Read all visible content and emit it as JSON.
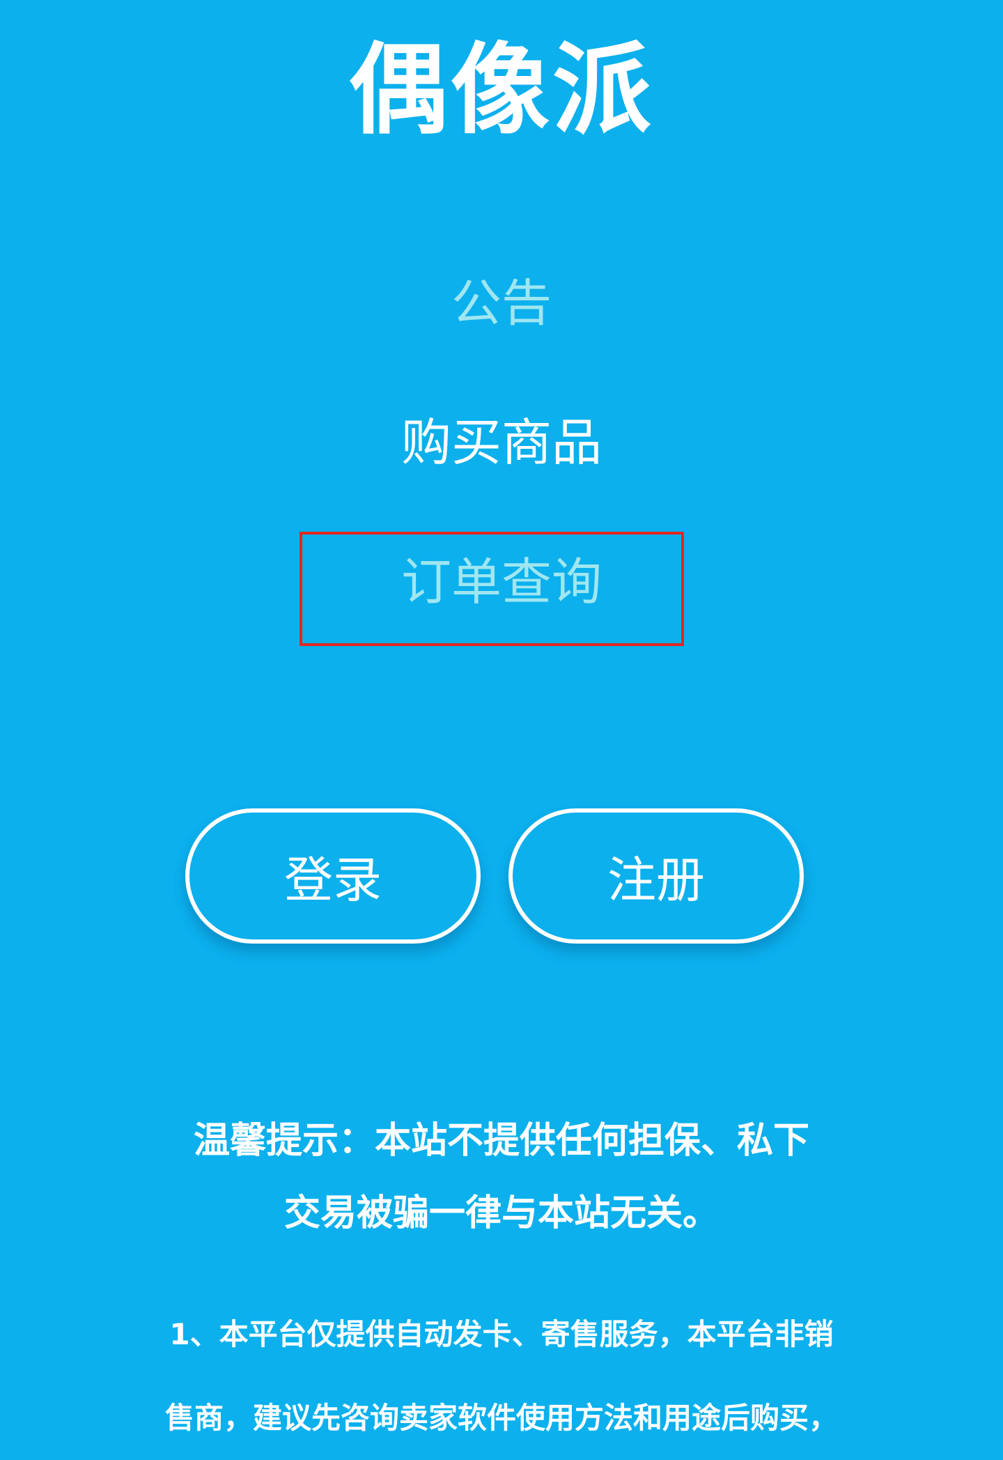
{
  "site": {
    "title": "偶像派"
  },
  "nav": {
    "notice": "公告",
    "buy": "购买商品",
    "order_query": "订单查询"
  },
  "auth": {
    "login_label": "登录",
    "register_label": "注册"
  },
  "notice": {
    "line1": "温馨提示：本站不提供任何担保、私下",
    "line2": "交易被骗一律与本站无关。"
  },
  "rules": {
    "line1": "1、本平台仅提供自动发卡、寄售服务，本平台非销",
    "line2": "售商，建议先咨询卖家软件使用方法和用途后购买，"
  },
  "colors": {
    "background": "#0bb0ed",
    "highlight": "#e5251f",
    "muted_link": "#9fe6f1"
  }
}
